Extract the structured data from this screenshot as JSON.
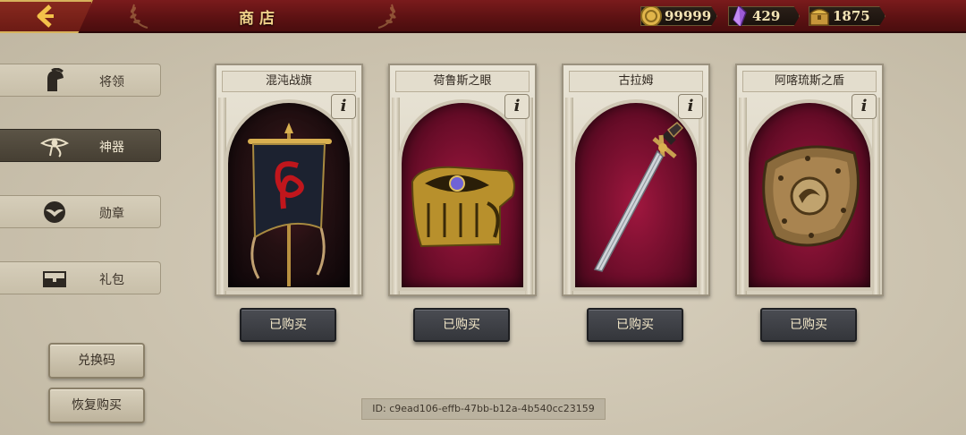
{
  "header": {
    "title": "商店",
    "back_icon": "chevron-left-icon",
    "currencies": [
      {
        "name": "gold-coin-icon",
        "value": "99999"
      },
      {
        "name": "purple-crystal-icon",
        "value": "429"
      },
      {
        "name": "treasure-chest-icon",
        "value": "1875"
      }
    ]
  },
  "sidebar": {
    "items": [
      {
        "label": "将领",
        "icon": "spartan-helmet-icon"
      },
      {
        "label": "神器",
        "icon": "eye-of-horus-icon",
        "active": true
      },
      {
        "label": "勋章",
        "icon": "eagle-medal-icon"
      },
      {
        "label": "礼包",
        "icon": "chest-icon"
      }
    ],
    "redeem_label": "兑换码",
    "restore_label": "恢复购买"
  },
  "products": [
    {
      "name": "混沌战旗",
      "button": "已购买",
      "icon": "chaos-banner-icon"
    },
    {
      "name": "荷鲁斯之眼",
      "button": "已购买",
      "icon": "eye-of-horus-ring-icon"
    },
    {
      "name": "古拉姆",
      "button": "已购买",
      "icon": "sword-icon"
    },
    {
      "name": "阿喀琉斯之盾",
      "button": "已购买",
      "icon": "shield-icon"
    }
  ],
  "info_label": "i",
  "footer": {
    "id_text": "ID: c9ead106-effb-47bb-b12a-4b540cc23159"
  },
  "colors": {
    "topbar": "#5b1112",
    "accent_gold": "#f1d28a",
    "card_bg": "#6d0d2a",
    "button_dark": "#3a3c41"
  }
}
